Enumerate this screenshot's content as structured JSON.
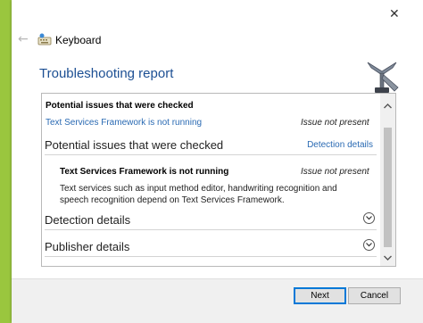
{
  "window": {
    "wizard_name": "Keyboard",
    "close_icon": "close-icon",
    "back_icon": "back-arrow-icon"
  },
  "main": {
    "heading": "Troubleshooting report",
    "report": {
      "summary_heading": "Potential issues that were checked",
      "summary_issue": "Text Services Framework is not running",
      "summary_status": "Issue not present",
      "section_issues": "Potential issues that were checked",
      "detection_link": "Detection details",
      "issue_title": "Text Services Framework is not running",
      "issue_status": "Issue not present",
      "issue_description": "Text services such as input method editor, handwriting recognition and speech recognition depend on Text Services Framework.",
      "section_detection": "Detection details",
      "section_publisher": "Publisher details"
    }
  },
  "footer": {
    "next_label": "Next",
    "cancel_label": "Cancel"
  },
  "colors": {
    "desktop": "#9ac63e",
    "heading": "#1c4f93",
    "link": "#2a6ab3",
    "button_focus": "#0078d7"
  }
}
